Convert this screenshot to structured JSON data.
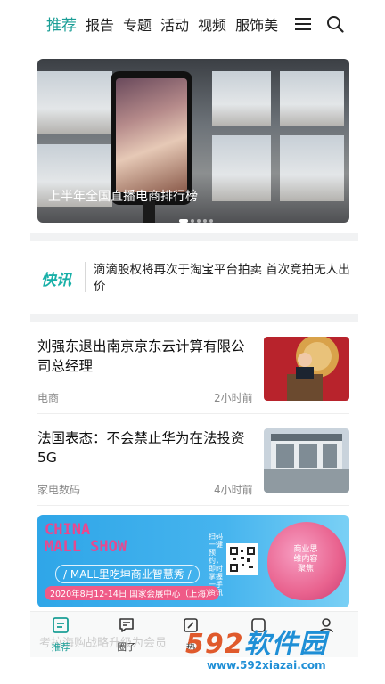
{
  "topnav": {
    "tabs": [
      "推荐",
      "报告",
      "专题",
      "活动",
      "视频",
      "服饰美"
    ],
    "active_tab": "推荐",
    "accent": "#1a9e96",
    "menu_icon": "hamburger-menu-icon",
    "search_icon": "search-icon"
  },
  "banner": {
    "caption": "上半年全国直播电商排行榜",
    "slides": 5,
    "active_slide": 1
  },
  "flash": {
    "tag": "快讯",
    "text": "滴滴股权将再次于淘宝平台拍卖 首次竞拍无人出价"
  },
  "news": [
    {
      "title": "刘强东退出南京京东云计算有限公司总经理",
      "category": "电商",
      "time": "2小时前"
    },
    {
      "title": "法国表态：不会禁止华为在法投资5G",
      "category": "家电数码",
      "time": "4小时前"
    }
  ],
  "ad": {
    "logo_line1": "CHINA",
    "logo_line2": "MALL SHOW",
    "slogan": "/ MALL里吃坤商业智慧秀 /",
    "date": "2020年8月12-14日  国家会展中心（上海）",
    "scan": "扫码一键预约，即时掌握一手资讯",
    "brain_text": "商业思维内容聚焦",
    "brand_color": "#e7498f"
  },
  "bottombar": {
    "ticker": "考拉海购战略升级为会员",
    "items": [
      {
        "label": "推荐",
        "icon": "document-icon",
        "active": true
      },
      {
        "label": "圈子",
        "icon": "chat-bubble-icon",
        "active": false
      },
      {
        "label": "热",
        "icon": "edit-icon",
        "active": false
      },
      {
        "label": "",
        "icon": "square-icon",
        "active": false
      },
      {
        "label": "",
        "icon": "profile-icon",
        "active": false
      }
    ]
  },
  "watermark": {
    "main_num": "592",
    "main_text": "软件园",
    "url": "www.592xiazai.com"
  }
}
